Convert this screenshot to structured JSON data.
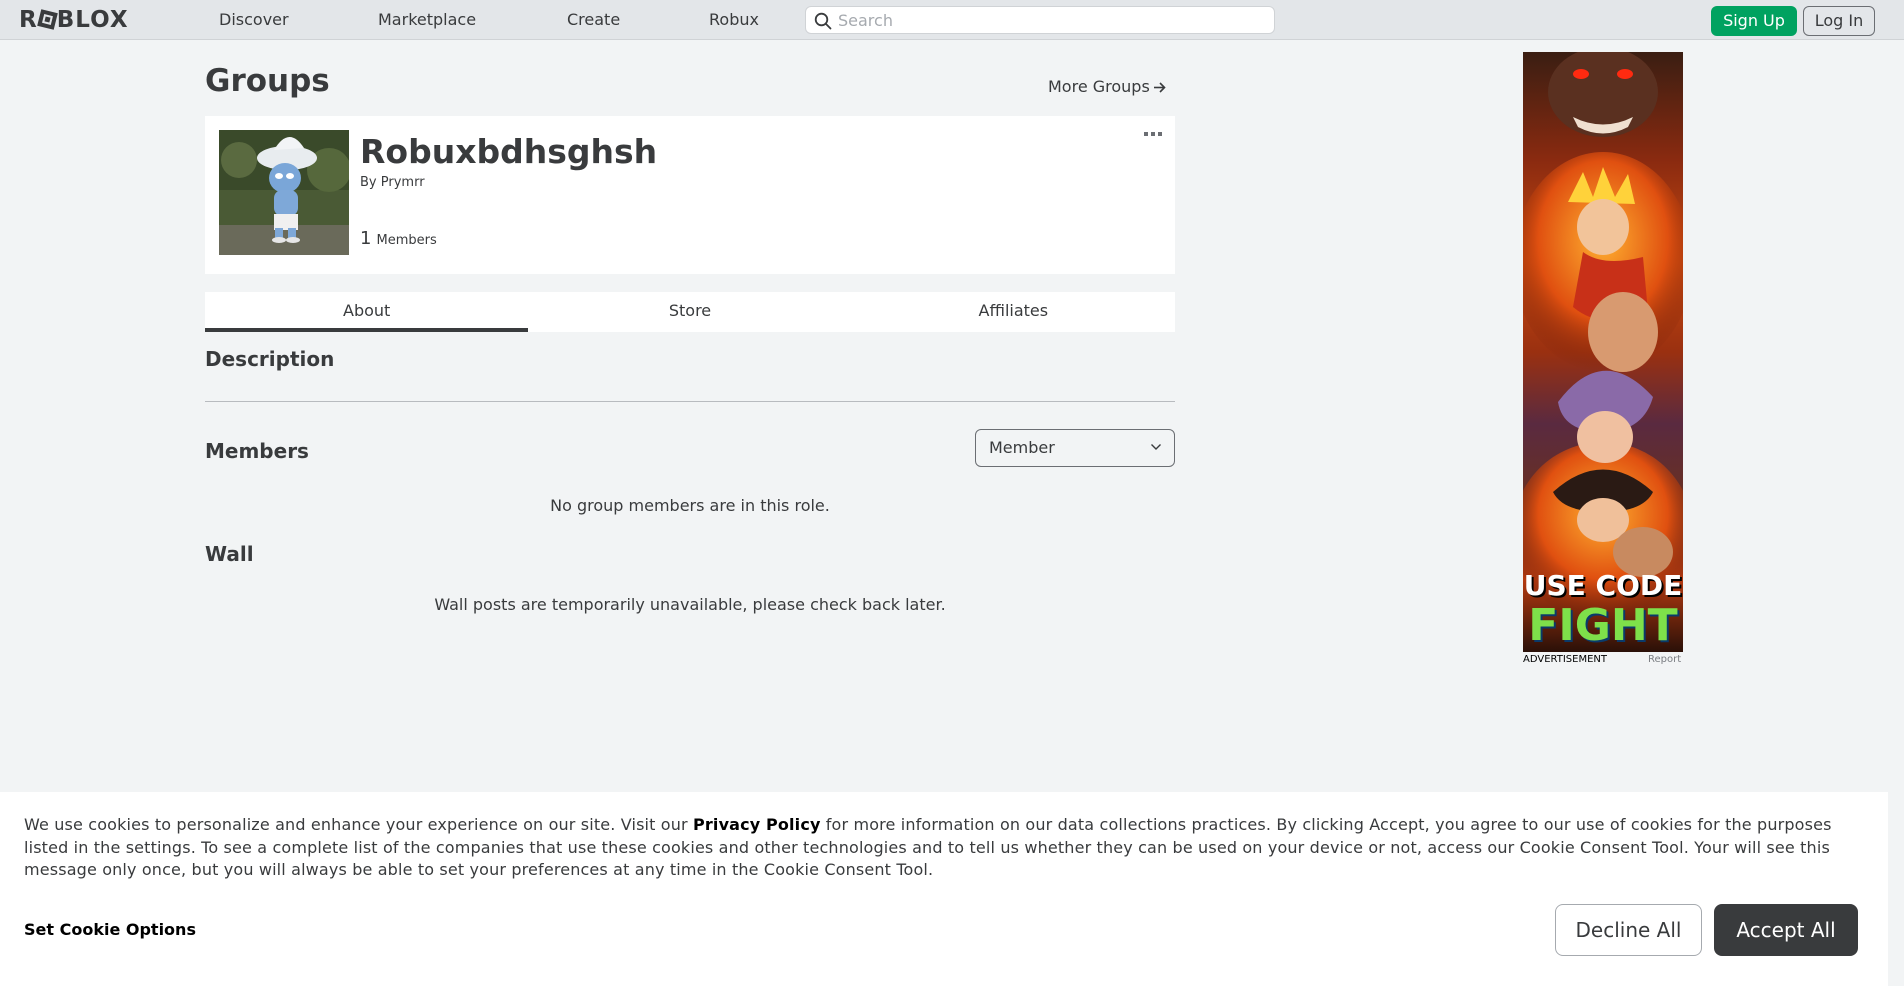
{
  "header": {
    "logo_text_1": "R",
    "logo_text_2": "BLOX",
    "nav": [
      "Discover",
      "Marketplace",
      "Create",
      "Robux"
    ],
    "search_placeholder": "Search",
    "signup_label": "Sign Up",
    "login_label": "Log In"
  },
  "page": {
    "title": "Groups",
    "more_groups": "More Groups"
  },
  "group": {
    "name": "Robuxbdhsghsh",
    "by_prefix": "By",
    "owner": "Prymrr",
    "member_count": "1",
    "member_label": "Members"
  },
  "tabs": [
    "About",
    "Store",
    "Affiliates"
  ],
  "about": {
    "description_heading": "Description",
    "members_heading": "Members",
    "role_selected": "Member",
    "members_empty": "No group members are in this role.",
    "wall_heading": "Wall",
    "wall_message": "Wall posts are temporarily unavailable, please check back later."
  },
  "ad": {
    "code_line_1": "USE CODE",
    "code_line_2": "FIGHT",
    "label": "ADVERTISEMENT",
    "report": "Report"
  },
  "cookie": {
    "text_before": "We use cookies to personalize and enhance your experience on our site. Visit our ",
    "policy_link": "Privacy Policy",
    "text_after": " for more information on our data collections practices. By clicking Accept, you agree to our use of cookies for the purposes listed in the settings. To see a complete list of the companies that use these cookies and other technologies and to tell us whether they can be used on your device or not, access our Cookie Consent Tool. Your will see this message only once, but you will always be able to set your preferences at any time in the Cookie Consent Tool.",
    "options_label": "Set Cookie Options",
    "decline_label": "Decline All",
    "accept_label": "Accept All"
  },
  "colors": {
    "accent_green": "#00a260",
    "text_dark": "#393b3d",
    "page_bg": "#f2f4f5"
  }
}
